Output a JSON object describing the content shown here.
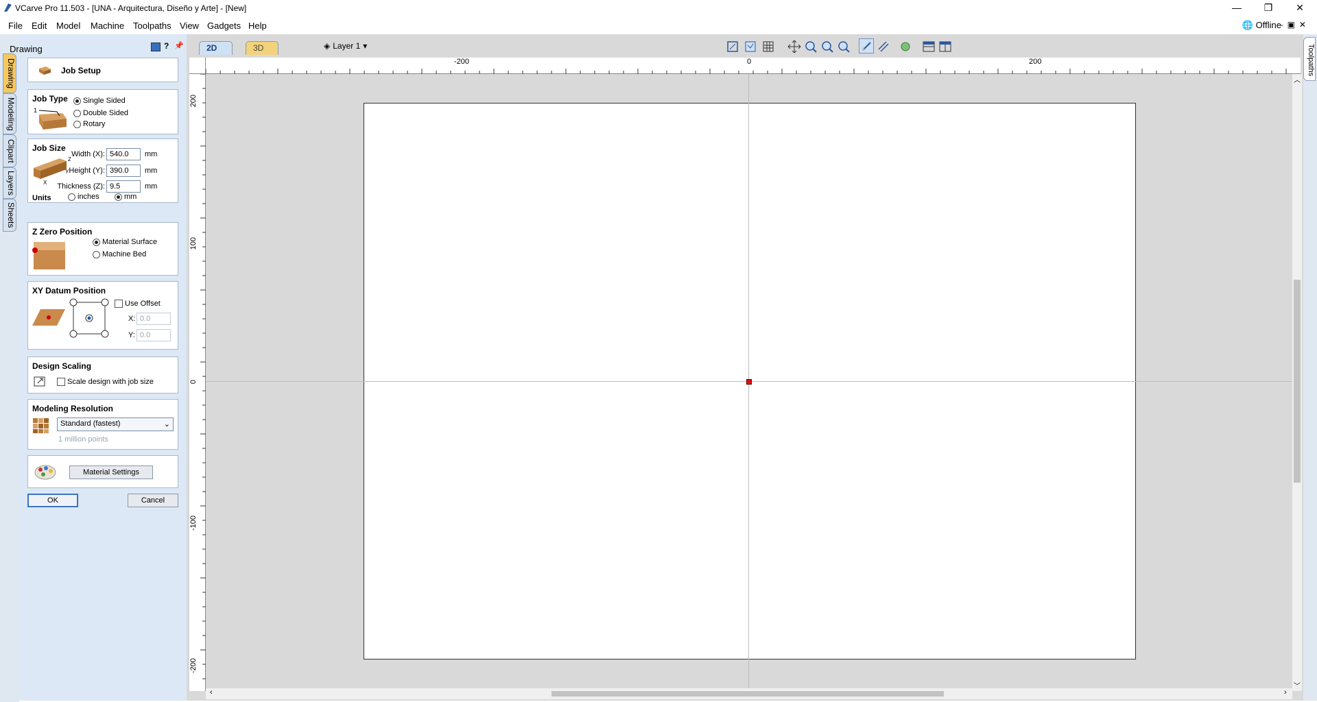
{
  "window": {
    "title": "VCarve Pro 11.503 - [UNA - Arquitectura, Diseño y Arte] - [New]",
    "minimize": "—",
    "restore": "❐",
    "close": "✕"
  },
  "menu": [
    "File",
    "Edit",
    "Model",
    "Machine",
    "Toolpaths",
    "View",
    "Gadgets",
    "Help"
  ],
  "status": {
    "offline": "Offline"
  },
  "left_tabs": [
    "Drawing",
    "Modeling",
    "Clipart",
    "Layers",
    "Sheets"
  ],
  "panel": {
    "header": "Drawing",
    "job_setup": "Job Setup",
    "job_type": {
      "title": "Job Type",
      "options": [
        "Single Sided",
        "Double Sided",
        "Rotary"
      ],
      "selected": "Single Sided"
    },
    "job_size": {
      "title": "Job Size",
      "width_label": "Width (X):",
      "width": "540.0",
      "height_label": "Height (Y):",
      "height": "390.0",
      "thickness_label": "Thickness (Z):",
      "thickness": "9.5",
      "unit": "mm",
      "units_label": "Units",
      "unit_options": [
        "inches",
        "mm"
      ],
      "unit_selected": "mm"
    },
    "z_zero": {
      "title": "Z Zero Position",
      "options": [
        "Material Surface",
        "Machine Bed"
      ],
      "selected": "Material Surface"
    },
    "xy_datum": {
      "title": "XY Datum Position",
      "use_offset": "Use Offset",
      "x_label": "X:",
      "x": "0.0",
      "y_label": "Y:",
      "y": "0.0"
    },
    "design_scaling": {
      "title": "Design Scaling",
      "checkbox": "Scale design with job size"
    },
    "modeling_resolution": {
      "title": "Modeling Resolution",
      "selected": "Standard (fastest)",
      "hint": "1 million points"
    },
    "material_settings": "Material Settings",
    "ok": "OK",
    "cancel": "Cancel"
  },
  "view_tabs": [
    "2D View",
    "3D View"
  ],
  "layer": "Layer 1",
  "right_tab": "Toolpaths",
  "ruler": {
    "h_labels": [
      "-200",
      "0",
      "200"
    ],
    "v_labels": [
      "200",
      "100",
      "0",
      "-100",
      "-200"
    ]
  }
}
